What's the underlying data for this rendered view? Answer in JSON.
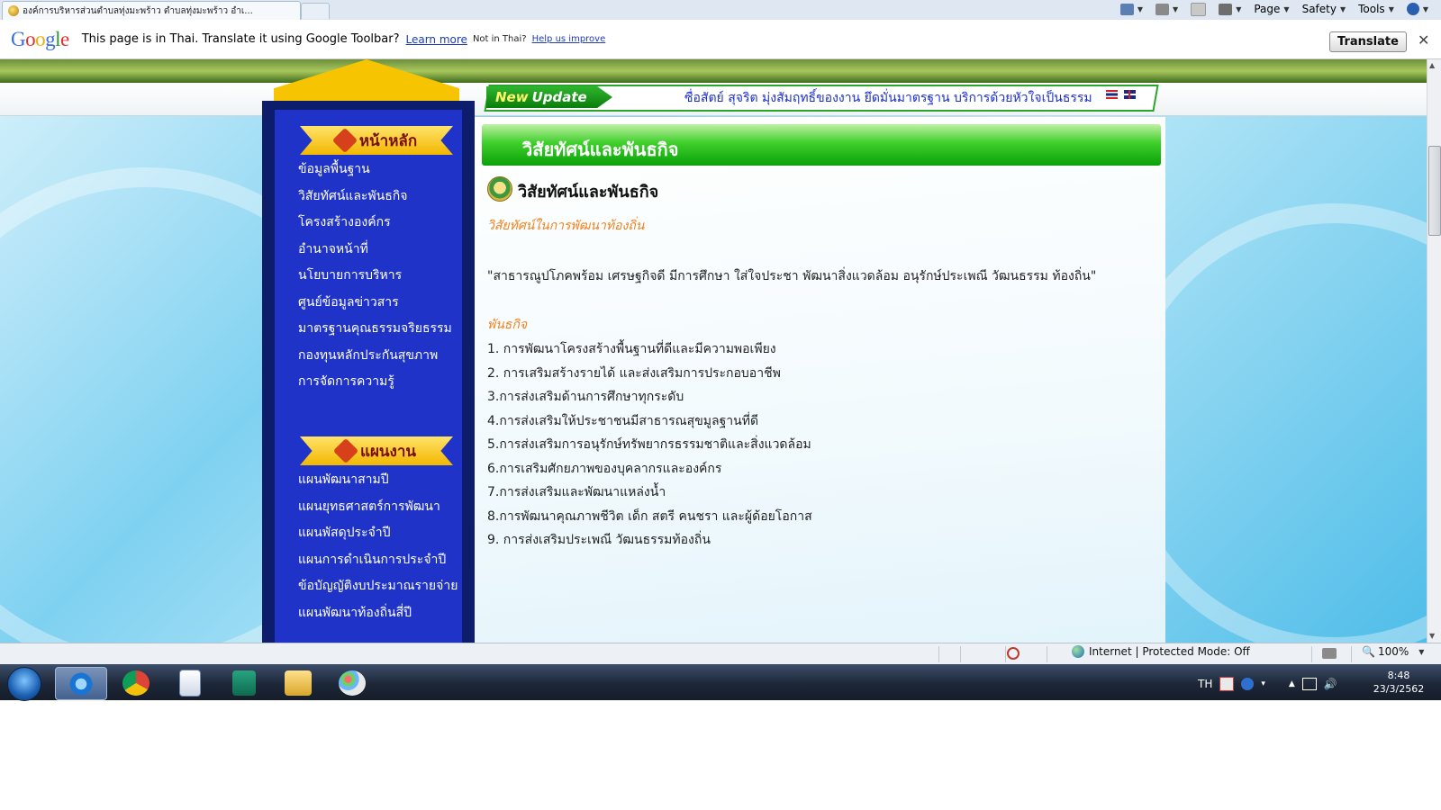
{
  "browser": {
    "tab_title": "องค์การบริหารส่วนตำบลทุ่งมะพร้าว ตำบลทุ่งมะพร้าว อำเ...",
    "command_bar": {
      "page": "Page",
      "safety": "Safety",
      "tools": "Tools"
    }
  },
  "google_toolbar": {
    "logo": "Google",
    "message": "This page is in Thai.  Translate it using Google Toolbar?",
    "learn_more": "Learn more",
    "not_in_thai": "Not in Thai?",
    "help_improve": "Help us improve",
    "translate_button": "Translate",
    "close": "✕"
  },
  "site": {
    "ticker": {
      "badge_new": "New",
      "badge_update": "Update",
      "text": "ซื่อสัตย์ สุจริต มุ่งสัมฤทธิ์ของงาน ยึดมั่นมาตรฐาน บริการด้วยหัวใจเป็นธรรม"
    },
    "nav": {
      "main_header": "หน้าหลัก",
      "main_items": [
        "ข้อมูลพื้นฐาน",
        "วิสัยทัศน์และพันธกิจ",
        "โครงสร้างองค์กร",
        "อำนาจหน้าที่",
        "นโยบายการบริหาร",
        "ศูนย์ข้อมูลข่าวสาร",
        "มาตรฐานคุณธรรมจริยธรรม",
        "กองทุนหลักประกันสุขภาพ",
        "การจัดการความรู้"
      ],
      "plan_header": "แผนงาน",
      "plan_items": [
        "แผนพัฒนาสามปี",
        "แผนยุทธศาสตร์การพัฒนา",
        "แผนพัสดุประจำปี",
        "แผนการดำเนินการประจำปี",
        "ข้อบัญญัติงบประมาณรายจ่าย",
        "แผนพัฒนาท้องถิ่นสี่ปี"
      ]
    },
    "content": {
      "banner_title": "วิสัยทัศน์และพันธกิจ",
      "heading": "วิสัยทัศน์และพันธกิจ",
      "vision_subtitle": "วิสัยทัศน์ในการพัฒนาท้องถิ่น",
      "vision_text": "\"สาธารณูปโภคพร้อม เศรษฐกิจดี มีการศึกษา ใส่ใจประชา พัฒนาสิ่งแวดล้อม อนุรักษ์ประเพณี วัฒนธรรม ท้องถิ่น\"",
      "mission_subtitle": "พันธกิจ",
      "missions": [
        "1. การพัฒนาโครงสร้างพื้นฐานที่ดีและมีความพอเพียง",
        "2. การเสริมสร้างรายได้ และส่งเสริมการประกอบอาชีพ",
        "3.การส่งเสริมด้านการศึกษาทุกระดับ",
        "4.การส่งเสริมให้ประชาชนมีสาธารณสุขมูลฐานที่ดี",
        "5.การส่งเสริมการอนุรักษ์ทรัพยากรธรรมชาติและสิ่งแวดล้อม",
        "6.การเสริมศักยภาพของบุคลากรและองค์กร",
        "7.การส่งเสริมและพัฒนาแหล่งน้ำ",
        "8.การพัฒนาคุณภาพชีวิต เด็ก สตรี คนชรา และผู้ด้อยโอกาส",
        "9. การส่งเสริมประเพณี วัฒนธรรมท้องถิ่น"
      ]
    }
  },
  "status_bar": {
    "zone": "Internet | Protected Mode: Off",
    "zoom": "100%"
  },
  "taskbar": {
    "language": "TH",
    "time": "8:48",
    "date": "23/3/2562"
  },
  "colors": {
    "nav_navy": "#0d1c6b",
    "nav_blue": "#1f33c8",
    "header_gold": "#f6c400",
    "banner_green": "#0aa10a",
    "accent_orange": "#f0821e",
    "link_blue": "#1c3bb8"
  }
}
